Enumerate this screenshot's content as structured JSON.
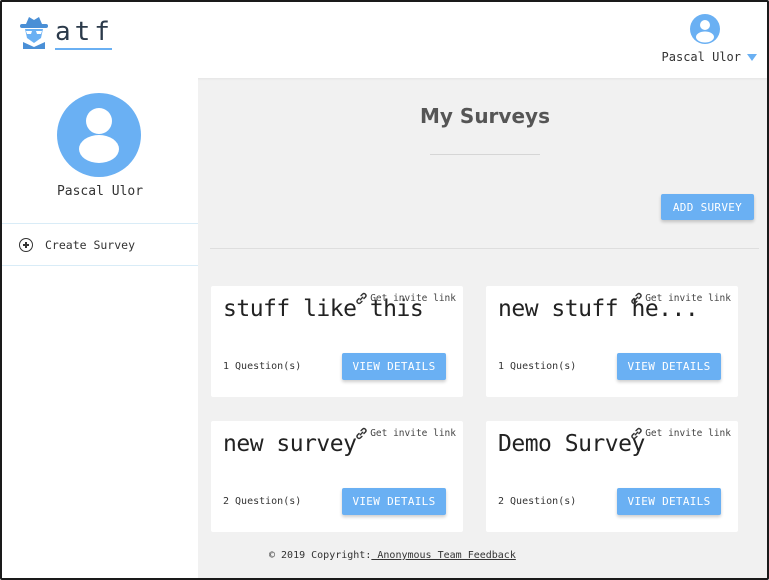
{
  "header": {
    "logo_text": "atf",
    "user_name": "Pascal Ulor"
  },
  "sidebar": {
    "profile_name": "Pascal Ulor",
    "items": [
      {
        "label": "Create Survey",
        "icon": "plus-circle-icon"
      }
    ]
  },
  "main": {
    "title": "My Surveys",
    "add_button": "ADD SURVEY",
    "cards": [
      {
        "title": "stuff like this",
        "invite": "Get invite link",
        "questions": "1 Question(s)",
        "button": "VIEW DETAILS"
      },
      {
        "title": "new stuff he...",
        "invite": "Get invite link",
        "questions": "1 Question(s)",
        "button": "VIEW DETAILS"
      },
      {
        "title": "new survey",
        "invite": "Get invite link",
        "questions": "2 Question(s)",
        "button": "VIEW DETAILS"
      },
      {
        "title": "Demo Survey",
        "invite": "Get invite link",
        "questions": "2 Question(s)",
        "button": "VIEW DETAILS"
      }
    ]
  },
  "footer": {
    "prefix": "© 2019 Copyright:",
    "link": " Anonymous Team Feedback"
  },
  "colors": {
    "accent": "#6ab0f3",
    "background": "#f1f1f1"
  }
}
